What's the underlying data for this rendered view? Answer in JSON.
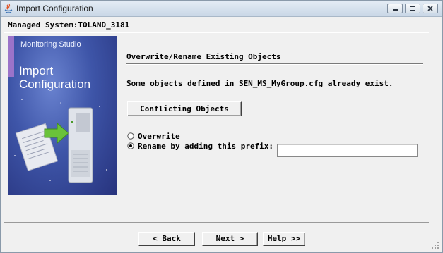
{
  "window": {
    "title": "Import Configuration",
    "app_icon": "java-app-icon",
    "controls": [
      "minimize-icon",
      "maximize-icon",
      "close-icon"
    ]
  },
  "header": {
    "managed_system": "Managed System:TOLAND_3181"
  },
  "banner": {
    "subtitle": "Monitoring Studio",
    "title_line1": "Import",
    "title_line2": "Configuration",
    "illustration": "document-to-server-illustration"
  },
  "section": {
    "title": "Overwrite/Rename Existing Objects",
    "message": "Some objects defined in SEN_MS_MyGroup.cfg already exist.",
    "conflict_button": "Conflicting Objects"
  },
  "options": {
    "overwrite_label": "Overwrite",
    "rename_label": "Rename by adding this prefix:",
    "selected": "rename",
    "prefix_value": ""
  },
  "footer": {
    "back_label": "< Back",
    "next_label": "Next >",
    "help_label": "Help >>"
  }
}
